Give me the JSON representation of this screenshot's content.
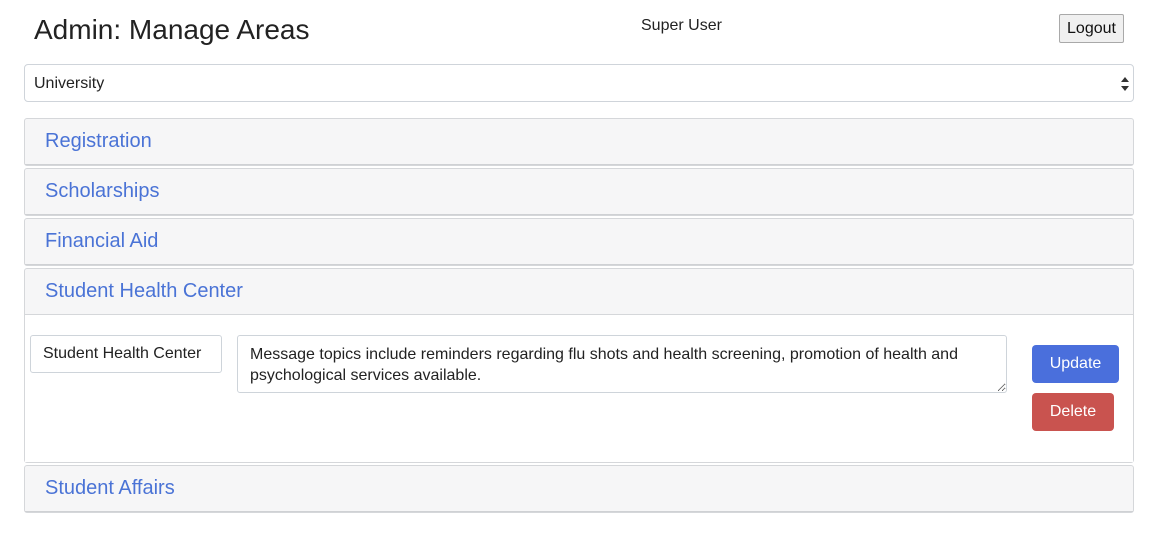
{
  "header": {
    "title": "Admin: Manage Areas",
    "user": "Super User",
    "logout_label": "Logout"
  },
  "area_select": {
    "selected": "University"
  },
  "accordion": {
    "items": [
      {
        "label": "Registration",
        "expanded": false
      },
      {
        "label": "Scholarships",
        "expanded": false
      },
      {
        "label": "Financial Aid",
        "expanded": false
      },
      {
        "label": "Student Health Center",
        "expanded": true
      },
      {
        "label": "Student Affairs",
        "expanded": false
      }
    ],
    "expanded_form": {
      "name_value": "Student Health Center",
      "description_value": "Message topics include reminders regarding flu shots and health screening, promotion of health and psychological services available.",
      "update_label": "Update",
      "delete_label": "Delete"
    }
  },
  "colors": {
    "link": "#4a73d6",
    "update_button": "#4a6fdc",
    "delete_button": "#c9534f",
    "panel_bg": "#f6f6f7"
  }
}
